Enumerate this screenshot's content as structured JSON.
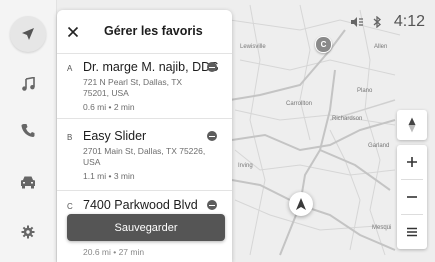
{
  "panel": {
    "title": "Gérer les favoris",
    "save_label": "Sauvegarder",
    "cut_off_text": "20.6 mi • 27 min"
  },
  "favorites": [
    {
      "letter": "A",
      "name": "Dr. marge M. najib, DDS",
      "address": "721 N Pearl St, Dallas, TX 75201, USA",
      "meta": "0.6 mi • 2 min"
    },
    {
      "letter": "B",
      "name": "Easy Slider",
      "address": "2701 Main St, Dallas, TX 75226, USA",
      "meta": "1.1 mi • 3 min"
    },
    {
      "letter": "C",
      "name": "7400 Parkwood Blvd",
      "address": "",
      "meta": ""
    }
  ],
  "status": {
    "time": "4:12"
  },
  "map": {
    "poi_letter": "C",
    "cities": [
      "Lewisville",
      "Allen",
      "Plano",
      "Carrollton",
      "Richardson",
      "Garland",
      "Irving",
      "Mesqui"
    ]
  },
  "colors": {
    "panel_bg": "#ffffff",
    "button_bg": "#555555",
    "map_bg": "#eeeeee",
    "road": "#c9c9c9"
  },
  "icons": [
    "navigation-arrow-icon",
    "music-note-icon",
    "phone-icon",
    "car-icon",
    "gear-icon",
    "close-icon",
    "minus-circle-icon",
    "mute-icon",
    "bluetooth-icon",
    "compass-icon",
    "plus-icon",
    "minus-icon",
    "menu-icon",
    "location-arrow-icon"
  ]
}
